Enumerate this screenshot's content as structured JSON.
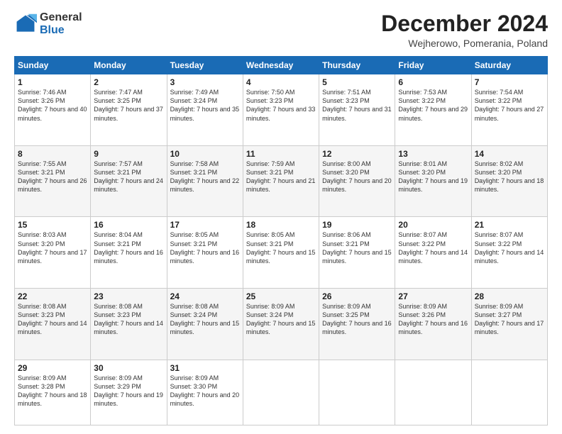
{
  "header": {
    "logo_line1": "General",
    "logo_line2": "Blue",
    "month_title": "December 2024",
    "subtitle": "Wejherowo, Pomerania, Poland"
  },
  "days_of_week": [
    "Sunday",
    "Monday",
    "Tuesday",
    "Wednesday",
    "Thursday",
    "Friday",
    "Saturday"
  ],
  "weeks": [
    [
      {
        "day": "1",
        "sunrise": "Sunrise: 7:46 AM",
        "sunset": "Sunset: 3:26 PM",
        "daylight": "Daylight: 7 hours and 40 minutes."
      },
      {
        "day": "2",
        "sunrise": "Sunrise: 7:47 AM",
        "sunset": "Sunset: 3:25 PM",
        "daylight": "Daylight: 7 hours and 37 minutes."
      },
      {
        "day": "3",
        "sunrise": "Sunrise: 7:49 AM",
        "sunset": "Sunset: 3:24 PM",
        "daylight": "Daylight: 7 hours and 35 minutes."
      },
      {
        "day": "4",
        "sunrise": "Sunrise: 7:50 AM",
        "sunset": "Sunset: 3:23 PM",
        "daylight": "Daylight: 7 hours and 33 minutes."
      },
      {
        "day": "5",
        "sunrise": "Sunrise: 7:51 AM",
        "sunset": "Sunset: 3:23 PM",
        "daylight": "Daylight: 7 hours and 31 minutes."
      },
      {
        "day": "6",
        "sunrise": "Sunrise: 7:53 AM",
        "sunset": "Sunset: 3:22 PM",
        "daylight": "Daylight: 7 hours and 29 minutes."
      },
      {
        "day": "7",
        "sunrise": "Sunrise: 7:54 AM",
        "sunset": "Sunset: 3:22 PM",
        "daylight": "Daylight: 7 hours and 27 minutes."
      }
    ],
    [
      {
        "day": "8",
        "sunrise": "Sunrise: 7:55 AM",
        "sunset": "Sunset: 3:21 PM",
        "daylight": "Daylight: 7 hours and 26 minutes."
      },
      {
        "day": "9",
        "sunrise": "Sunrise: 7:57 AM",
        "sunset": "Sunset: 3:21 PM",
        "daylight": "Daylight: 7 hours and 24 minutes."
      },
      {
        "day": "10",
        "sunrise": "Sunrise: 7:58 AM",
        "sunset": "Sunset: 3:21 PM",
        "daylight": "Daylight: 7 hours and 22 minutes."
      },
      {
        "day": "11",
        "sunrise": "Sunrise: 7:59 AM",
        "sunset": "Sunset: 3:21 PM",
        "daylight": "Daylight: 7 hours and 21 minutes."
      },
      {
        "day": "12",
        "sunrise": "Sunrise: 8:00 AM",
        "sunset": "Sunset: 3:20 PM",
        "daylight": "Daylight: 7 hours and 20 minutes."
      },
      {
        "day": "13",
        "sunrise": "Sunrise: 8:01 AM",
        "sunset": "Sunset: 3:20 PM",
        "daylight": "Daylight: 7 hours and 19 minutes."
      },
      {
        "day": "14",
        "sunrise": "Sunrise: 8:02 AM",
        "sunset": "Sunset: 3:20 PM",
        "daylight": "Daylight: 7 hours and 18 minutes."
      }
    ],
    [
      {
        "day": "15",
        "sunrise": "Sunrise: 8:03 AM",
        "sunset": "Sunset: 3:20 PM",
        "daylight": "Daylight: 7 hours and 17 minutes."
      },
      {
        "day": "16",
        "sunrise": "Sunrise: 8:04 AM",
        "sunset": "Sunset: 3:21 PM",
        "daylight": "Daylight: 7 hours and 16 minutes."
      },
      {
        "day": "17",
        "sunrise": "Sunrise: 8:05 AM",
        "sunset": "Sunset: 3:21 PM",
        "daylight": "Daylight: 7 hours and 16 minutes."
      },
      {
        "day": "18",
        "sunrise": "Sunrise: 8:05 AM",
        "sunset": "Sunset: 3:21 PM",
        "daylight": "Daylight: 7 hours and 15 minutes."
      },
      {
        "day": "19",
        "sunrise": "Sunrise: 8:06 AM",
        "sunset": "Sunset: 3:21 PM",
        "daylight": "Daylight: 7 hours and 15 minutes."
      },
      {
        "day": "20",
        "sunrise": "Sunrise: 8:07 AM",
        "sunset": "Sunset: 3:22 PM",
        "daylight": "Daylight: 7 hours and 14 minutes."
      },
      {
        "day": "21",
        "sunrise": "Sunrise: 8:07 AM",
        "sunset": "Sunset: 3:22 PM",
        "daylight": "Daylight: 7 hours and 14 minutes."
      }
    ],
    [
      {
        "day": "22",
        "sunrise": "Sunrise: 8:08 AM",
        "sunset": "Sunset: 3:23 PM",
        "daylight": "Daylight: 7 hours and 14 minutes."
      },
      {
        "day": "23",
        "sunrise": "Sunrise: 8:08 AM",
        "sunset": "Sunset: 3:23 PM",
        "daylight": "Daylight: 7 hours and 14 minutes."
      },
      {
        "day": "24",
        "sunrise": "Sunrise: 8:08 AM",
        "sunset": "Sunset: 3:24 PM",
        "daylight": "Daylight: 7 hours and 15 minutes."
      },
      {
        "day": "25",
        "sunrise": "Sunrise: 8:09 AM",
        "sunset": "Sunset: 3:24 PM",
        "daylight": "Daylight: 7 hours and 15 minutes."
      },
      {
        "day": "26",
        "sunrise": "Sunrise: 8:09 AM",
        "sunset": "Sunset: 3:25 PM",
        "daylight": "Daylight: 7 hours and 16 minutes."
      },
      {
        "day": "27",
        "sunrise": "Sunrise: 8:09 AM",
        "sunset": "Sunset: 3:26 PM",
        "daylight": "Daylight: 7 hours and 16 minutes."
      },
      {
        "day": "28",
        "sunrise": "Sunrise: 8:09 AM",
        "sunset": "Sunset: 3:27 PM",
        "daylight": "Daylight: 7 hours and 17 minutes."
      }
    ],
    [
      {
        "day": "29",
        "sunrise": "Sunrise: 8:09 AM",
        "sunset": "Sunset: 3:28 PM",
        "daylight": "Daylight: 7 hours and 18 minutes."
      },
      {
        "day": "30",
        "sunrise": "Sunrise: 8:09 AM",
        "sunset": "Sunset: 3:29 PM",
        "daylight": "Daylight: 7 hours and 19 minutes."
      },
      {
        "day": "31",
        "sunrise": "Sunrise: 8:09 AM",
        "sunset": "Sunset: 3:30 PM",
        "daylight": "Daylight: 7 hours and 20 minutes."
      },
      null,
      null,
      null,
      null
    ]
  ]
}
